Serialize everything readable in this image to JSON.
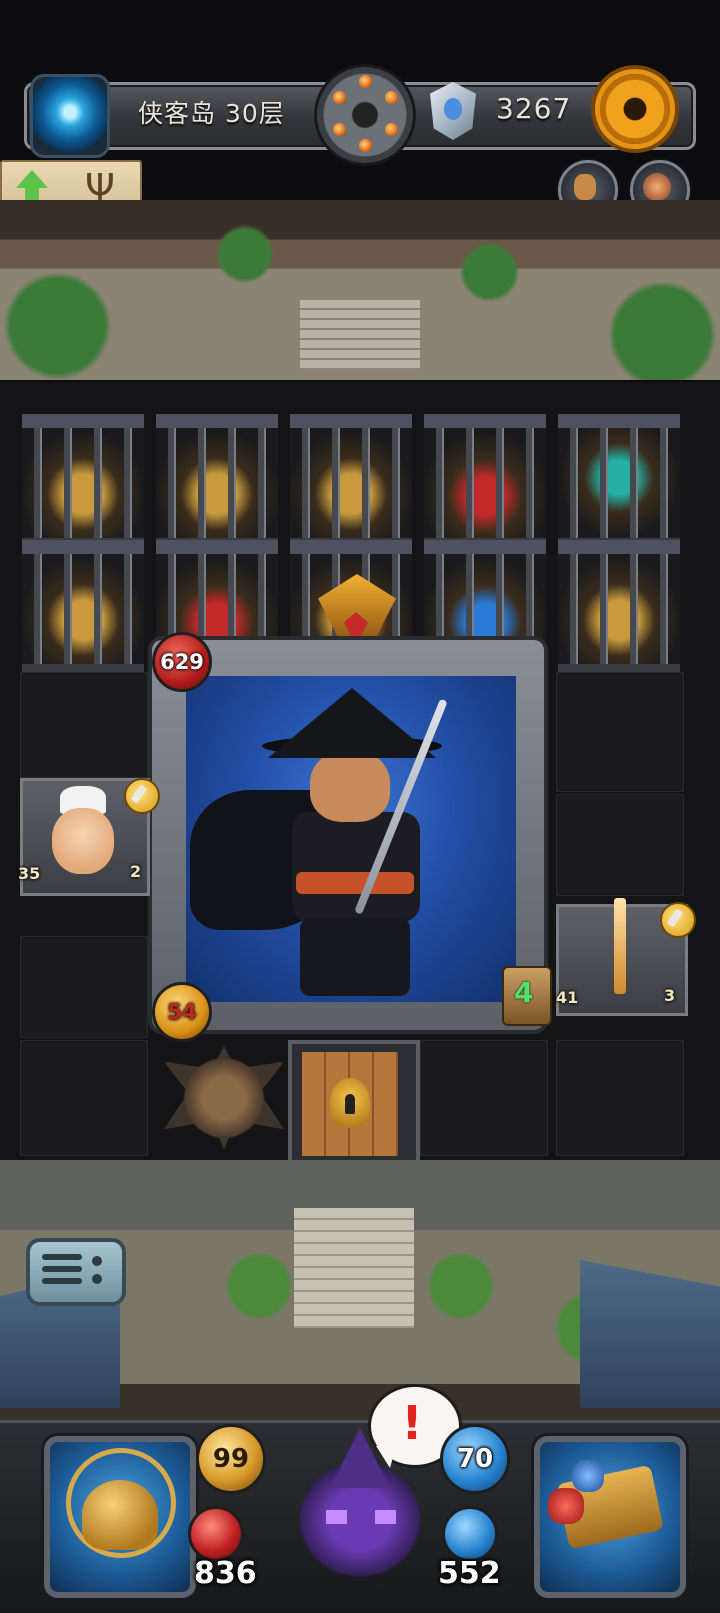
{
  "header": {
    "location_label": "侠客岛 30层",
    "currency_value": "3267",
    "currency_icon": "crystal-gem-icon",
    "settings_icon": "gear-icon",
    "portal_icon": "portal-icon",
    "revolver_icon": "revolver-cylinder-icon"
  },
  "floor_button": {
    "up_icon": "up-arrow-icon",
    "candelabra_icon": "candelabra-icon",
    "candelabra_glyph": "Ψ"
  },
  "round_buttons": [
    {
      "name": "coin-pouch-button",
      "icon": "coin-pouch-icon"
    },
    {
      "name": "companion-button",
      "icon": "companion-avatar-icon"
    }
  ],
  "board": {
    "enemy_hp": "629",
    "enemy_attack": "54",
    "npc_left": {
      "attack": "35",
      "count": "2"
    },
    "sword_item": {
      "count": "3"
    },
    "hourglass": {
      "value": "4",
      "bonus": "41"
    }
  },
  "hud": {
    "attack": "99",
    "health": "836",
    "defense": "70",
    "mana": "552",
    "alert_symbol": "!",
    "left_slot_icon": "golden-helmet-icon",
    "right_slot_icon": "treasure-book-icon",
    "hero_icon": "purple-demon-hero-icon"
  },
  "menu_icon": "menu-list-icon",
  "colors": {
    "gold": "#d89a16",
    "health_red": "#c02222",
    "mana_blue": "#2a86d2",
    "portrait_blue": "#234fa6"
  }
}
